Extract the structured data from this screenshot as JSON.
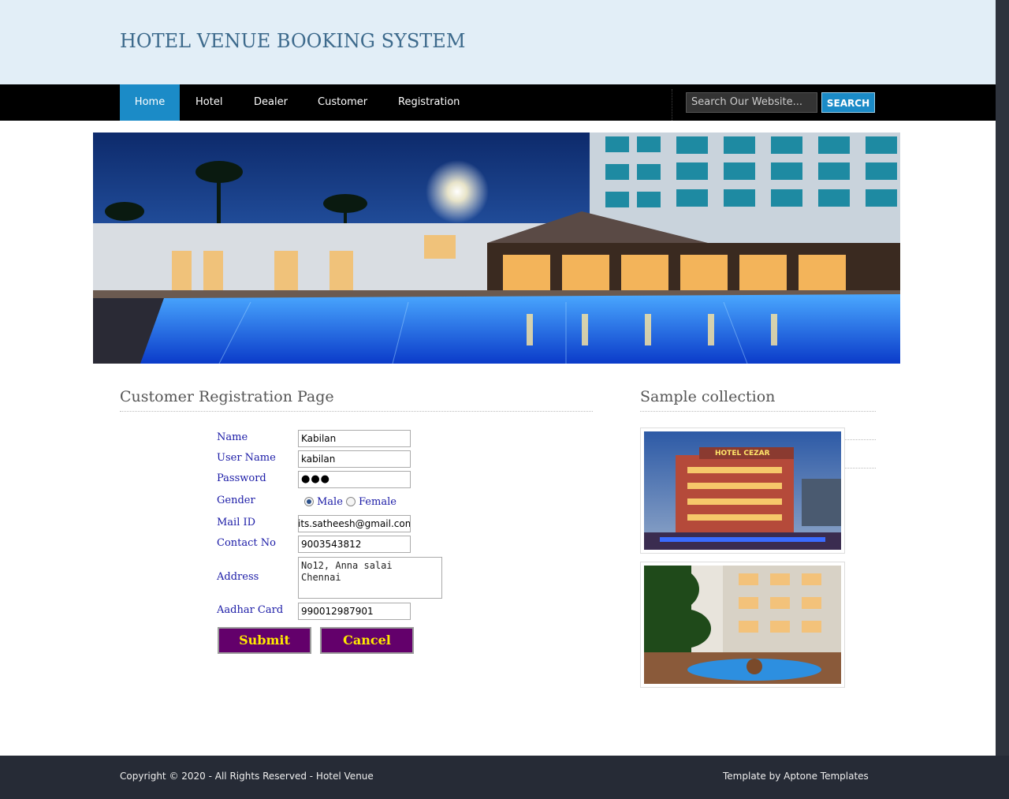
{
  "site": {
    "title": "HOTEL VENUE BOOKING SYSTEM"
  },
  "nav": {
    "items": [
      {
        "label": "Home"
      },
      {
        "label": "Hotel"
      },
      {
        "label": "Dealer"
      },
      {
        "label": "Customer"
      },
      {
        "label": "Registration"
      }
    ],
    "active": "Home"
  },
  "search": {
    "placeholder": "Search Our Website...",
    "button_label": "SEARCH"
  },
  "main": {
    "title": "Customer Registration Page",
    "form": {
      "name_label": "Name",
      "name_value": "Kabilan",
      "username_label": "User Name",
      "username_value": "kabilan",
      "password_label": "Password",
      "password_mask": "●●●",
      "gender_label": "Gender",
      "gender_male": "Male",
      "gender_female": "Female",
      "gender_selected": "Male",
      "mail_label": "Mail ID",
      "mail_value": "its.satheesh@gmail.com",
      "contact_label": "Contact No",
      "contact_value": "9003543812",
      "address_label": "Address",
      "address_value": "No12, Anna salai\nChennai",
      "aadhar_label": "Aadhar Card",
      "aadhar_value": "990012987901",
      "submit_label": "Submit",
      "cancel_label": "Cancel"
    }
  },
  "sidebar": {
    "title": "Sample collection"
  },
  "footer": {
    "copyright": "Copyright © 2020 - All Rights Reserved - Hotel Venue",
    "credit": "Template by Aptone Templates"
  },
  "colors": {
    "header_bg": "#e2eef7",
    "nav_bg": "#000000",
    "accent": "#1b8bc7",
    "button_bg": "#63006b",
    "button_text": "#ffea00",
    "footer_bg": "#262b36"
  },
  "thumb_texts": {
    "hotel_sign": "HOTEL CEZAR"
  }
}
